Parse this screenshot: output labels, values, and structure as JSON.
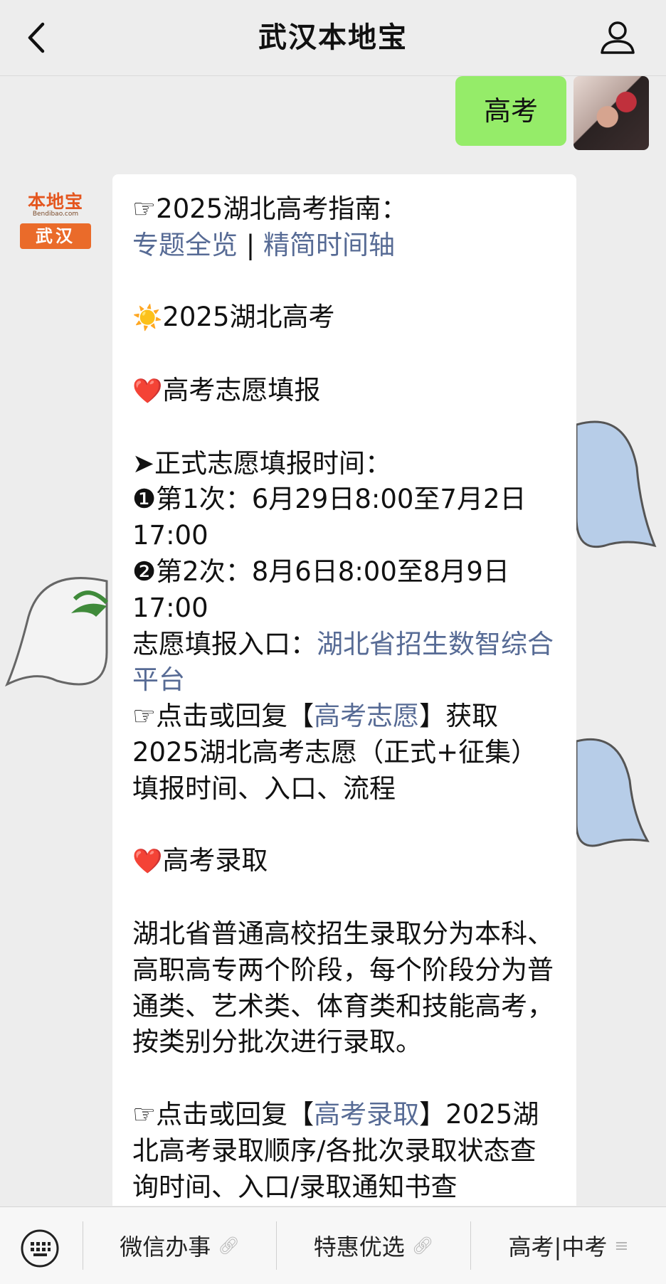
{
  "header": {
    "title": "武汉本地宝"
  },
  "user_message": {
    "text": "高考"
  },
  "bot": {
    "logo_top": "本地宝",
    "logo_sub": "Bendibao.com",
    "logo_city": "武汉"
  },
  "message": {
    "guide_label": "☞2025湖北高考指南：",
    "link_overview": "专题全览",
    "divider": "|",
    "link_timeline": "精简时间轴",
    "sun_emoji": "☀️",
    "section_title": "2025湖北高考",
    "heart_emoji": "❤️",
    "h_volunteer": "高考志愿填报",
    "time_label": "➤正式志愿填报时间：",
    "time_1": "❶第1次：6月29日8:00至7月2日17:00",
    "time_2": "❷第2次：8月6日8:00至8月9日17:00",
    "entry_label": "志愿填报入口：",
    "entry_link": "湖北省招生数智综合平台",
    "reply1_prefix": "☞点击或回复【",
    "reply1_link": "高考志愿",
    "reply1_suffix": "】获取2025湖北高考志愿（正式+征集）填报时间、入口、流程",
    "h_admission": "高考录取",
    "admission_body": "湖北省普通高校招生录取分为本科、高职高专两个阶段，每个阶段分为普通类、艺术类、体育类和技能高考，按类别分批次进行录取。",
    "reply2_prefix": "☞点击或回复【",
    "reply2_link": "高考录取",
    "reply2_suffix": "】2025湖北高考录取顺序/各批次录取状态查询时间、入口/录取通知书查"
  },
  "menu": {
    "item1": "微信办事",
    "item2": "特惠优选",
    "item3": "高考|中考",
    "item1_icon": "link-icon",
    "item2_icon": "link-icon",
    "item3_icon": "list-icon"
  },
  "colors": {
    "accent_link": "#576b95",
    "self_bubble": "#95ec69",
    "brand": "#ea6b2a"
  }
}
